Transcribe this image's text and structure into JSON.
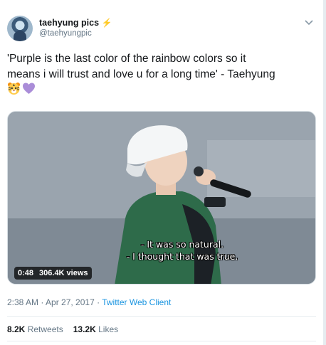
{
  "author": {
    "display_name": "taehyung pics",
    "badge": "⚡",
    "handle": "@taehyungpic"
  },
  "icons": {
    "caret": "chevron-down-icon",
    "badge": "lightning-icon"
  },
  "tweet": {
    "text": "'Purple is the last color of the rainbow colors so it\nmeans i will trust and love u for a long time' - Taehyung",
    "emojis": [
      "🐯",
      "💜"
    ]
  },
  "media": {
    "subtitle_line1": "- It was so natural.",
    "subtitle_line2": "- I thought that was true.",
    "duration": "0:48",
    "views": "306.4K views"
  },
  "meta": {
    "timestamp": "2:38 AM · Apr 27, 2017",
    "separator": " · ",
    "client": "Twitter Web Client"
  },
  "stats": {
    "retweets_count": "8.2K",
    "retweets_label": "Retweets",
    "likes_count": "13.2K",
    "likes_label": "Likes"
  },
  "colors": {
    "link": "#1b95e0",
    "secondary_text": "#657786",
    "badge": "#f5a623"
  }
}
